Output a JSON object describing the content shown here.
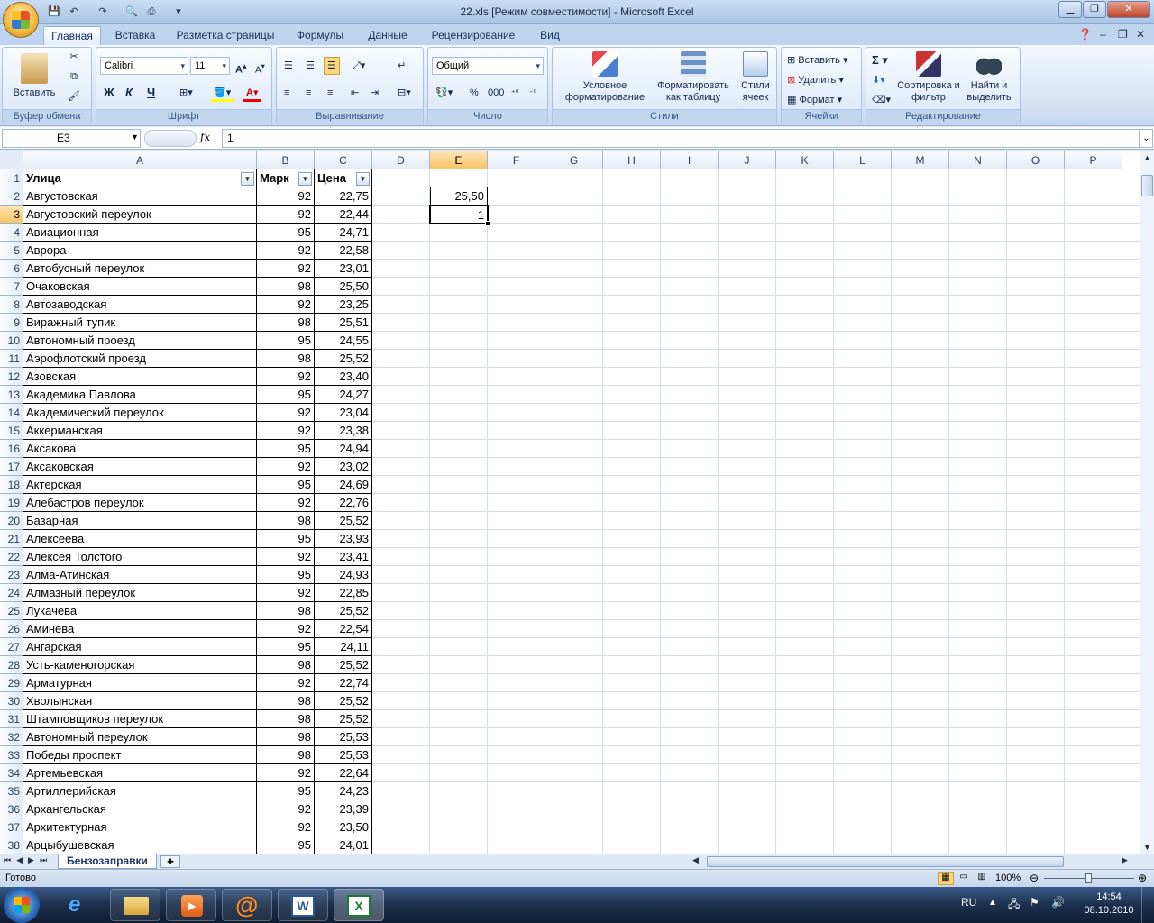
{
  "window": {
    "title": "22.xls  [Режим совместимости] - Microsoft Excel"
  },
  "ribbon_tabs": [
    "Главная",
    "Вставка",
    "Разметка страницы",
    "Формулы",
    "Данные",
    "Рецензирование",
    "Вид"
  ],
  "ribbon": {
    "paste_label": "Вставить",
    "font_name": "Calibri",
    "font_size": "11",
    "bold": "Ж",
    "italic": "К",
    "underline": "Ч",
    "number_format": "Общий",
    "percent": "%",
    "thousands": "000",
    "cond_format": "Условное форматирование",
    "format_table": "Форматировать как таблицу",
    "cell_styles": "Стили ячеек",
    "insert": "Вставить",
    "delete": "Удалить",
    "format": "Формат",
    "sigma": "Σ",
    "sort_filter": "Сортировка и фильтр",
    "find_select": "Найти и выделить",
    "groups": [
      "Буфер обмена",
      "Шрифт",
      "Выравнивание",
      "Число",
      "Стили",
      "Ячейки",
      "Редактирование"
    ]
  },
  "formula_bar": {
    "name_box": "E3",
    "fx": "fx",
    "value": "1"
  },
  "columns": [
    "A",
    "B",
    "C",
    "D",
    "E",
    "F",
    "G",
    "H",
    "I",
    "J",
    "K",
    "L",
    "M",
    "N",
    "O",
    "P"
  ],
  "headers": {
    "a": "Улица",
    "b": "Марк",
    "c": "Цена"
  },
  "rows": [
    {
      "n": "2",
      "street": "Августовская",
      "brand": "92",
      "price": "22,75"
    },
    {
      "n": "3",
      "street": "Августовский переулок",
      "brand": "92",
      "price": "22,44"
    },
    {
      "n": "4",
      "street": "Авиационная",
      "brand": "95",
      "price": "24,71"
    },
    {
      "n": "5",
      "street": "Аврора",
      "brand": "92",
      "price": "22,58"
    },
    {
      "n": "6",
      "street": "Автобусный переулок",
      "brand": "92",
      "price": "23,01"
    },
    {
      "n": "7",
      "street": "Очаковская",
      "brand": "98",
      "price": "25,50"
    },
    {
      "n": "8",
      "street": "Автозаводская",
      "brand": "92",
      "price": "23,25"
    },
    {
      "n": "9",
      "street": "Виражный тупик",
      "brand": "98",
      "price": "25,51"
    },
    {
      "n": "10",
      "street": "Автономный проезд",
      "brand": "95",
      "price": "24,55"
    },
    {
      "n": "11",
      "street": "Аэрофлотский проезд",
      "brand": "98",
      "price": "25,52"
    },
    {
      "n": "12",
      "street": "Азовская",
      "brand": "92",
      "price": "23,40"
    },
    {
      "n": "13",
      "street": "Академика Павлова",
      "brand": "95",
      "price": "24,27"
    },
    {
      "n": "14",
      "street": "Академический переулок",
      "brand": "92",
      "price": "23,04"
    },
    {
      "n": "15",
      "street": "Аккерманская",
      "brand": "92",
      "price": "23,38"
    },
    {
      "n": "16",
      "street": "Аксакова",
      "brand": "95",
      "price": "24,94"
    },
    {
      "n": "17",
      "street": "Аксаковская",
      "brand": "92",
      "price": "23,02"
    },
    {
      "n": "18",
      "street": "Актерская",
      "brand": "95",
      "price": "24,69"
    },
    {
      "n": "19",
      "street": "Алебастров переулок",
      "brand": "92",
      "price": "22,76"
    },
    {
      "n": "20",
      "street": "Базарная",
      "brand": "98",
      "price": "25,52"
    },
    {
      "n": "21",
      "street": "Алексеева",
      "brand": "95",
      "price": "23,93"
    },
    {
      "n": "22",
      "street": "Алексея Толстого",
      "brand": "92",
      "price": "23,41"
    },
    {
      "n": "23",
      "street": "Алма-Атинская",
      "brand": "95",
      "price": "24,93"
    },
    {
      "n": "24",
      "street": "Алмазный переулок",
      "brand": "92",
      "price": "22,85"
    },
    {
      "n": "25",
      "street": "Лукачева",
      "brand": "98",
      "price": "25,52"
    },
    {
      "n": "26",
      "street": "Аминева",
      "brand": "92",
      "price": "22,54"
    },
    {
      "n": "27",
      "street": "Ангарская",
      "brand": "95",
      "price": "24,11"
    },
    {
      "n": "28",
      "street": "Усть-каменогорская",
      "brand": "98",
      "price": "25,52"
    },
    {
      "n": "29",
      "street": "Арматурная",
      "brand": "92",
      "price": "22,74"
    },
    {
      "n": "30",
      "street": "Хволынская",
      "brand": "98",
      "price": "25,52"
    },
    {
      "n": "31",
      "street": "Штамповщиков переулок",
      "brand": "98",
      "price": "25,52"
    },
    {
      "n": "32",
      "street": "Автономный переулок",
      "brand": "98",
      "price": "25,53"
    },
    {
      "n": "33",
      "street": "Победы проспект",
      "brand": "98",
      "price": "25,53"
    },
    {
      "n": "34",
      "street": "Артемьевская",
      "brand": "92",
      "price": "22,64"
    },
    {
      "n": "35",
      "street": "Артиллерийская",
      "brand": "95",
      "price": "24,23"
    },
    {
      "n": "36",
      "street": "Архангельская",
      "brand": "92",
      "price": "23,39"
    },
    {
      "n": "37",
      "street": "Архитектурная",
      "brand": "92",
      "price": "23,50"
    },
    {
      "n": "38",
      "street": "Арцыбушевская",
      "brand": "95",
      "price": "24,01"
    }
  ],
  "cells": {
    "E2": "25,50",
    "E3": "1"
  },
  "sheet_tab": "Бензозаправки",
  "status": {
    "ready": "Готово",
    "zoom": "100%"
  },
  "taskbar": {
    "lang": "RU",
    "time": "14:54",
    "date": "08.10.2010"
  },
  "colors": {
    "accent": "#f7c565",
    "ribbon": "#dfe8f5",
    "excel_green": "#1e7b34"
  }
}
